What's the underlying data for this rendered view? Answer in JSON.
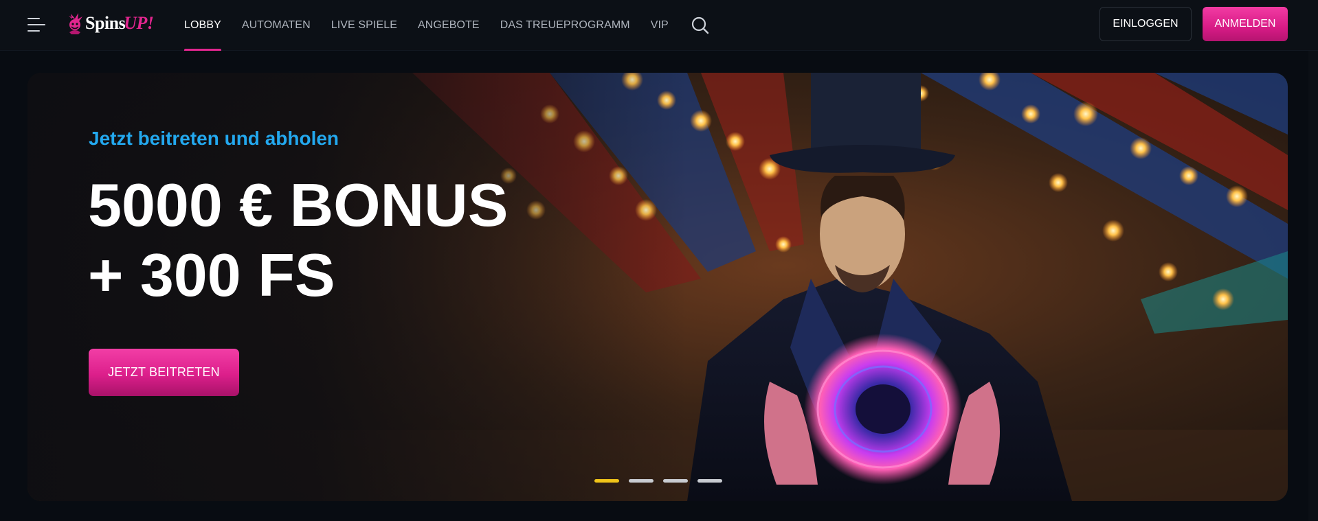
{
  "brand": {
    "name_part1": "Spins",
    "name_part2": "UP!",
    "accent_color": "#e2268f"
  },
  "nav": {
    "items": [
      {
        "label": "LOBBY",
        "active": true
      },
      {
        "label": "AUTOMATEN",
        "active": false
      },
      {
        "label": "LIVE SPIELE",
        "active": false
      },
      {
        "label": "ANGEBOTE",
        "active": false
      },
      {
        "label": "DAS TREUEPROGRAMM",
        "active": false
      },
      {
        "label": "VIP",
        "active": false
      }
    ],
    "icons": {
      "menu": "hamburger-icon",
      "search": "search-icon"
    }
  },
  "auth": {
    "login_label": "EINLOGGEN",
    "register_label": "ANMELDEN"
  },
  "hero": {
    "kicker": "Jetzt beitreten und abholen",
    "title_line1": "5000 € BONUS",
    "title_line2": "+ 300 FS",
    "cta_label": "JETZT BEITRETEN",
    "kicker_color": "#23a8ee",
    "slides": 4,
    "active_slide": 1,
    "active_dot_color": "#f0c419"
  }
}
